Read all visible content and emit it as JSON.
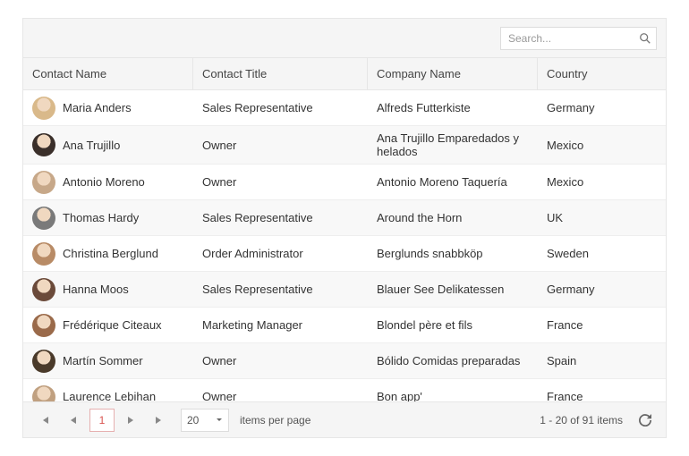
{
  "search": {
    "placeholder": "Search..."
  },
  "columns": {
    "name": "Contact Name",
    "title": "Contact Title",
    "company": "Company Name",
    "country": "Country"
  },
  "rows": [
    {
      "name": "Maria Anders",
      "title": "Sales Representative",
      "company": "Alfreds Futterkiste",
      "country": "Germany",
      "avatar": "#d9b98a"
    },
    {
      "name": "Ana Trujillo",
      "title": "Owner",
      "company": "Ana Trujillo Emparedados y helados",
      "country": "Mexico",
      "avatar": "#3a2f2a"
    },
    {
      "name": "Antonio Moreno",
      "title": "Owner",
      "company": "Antonio Moreno Taquería",
      "country": "Mexico",
      "avatar": "#c7a889"
    },
    {
      "name": "Thomas Hardy",
      "title": "Sales Representative",
      "company": "Around the Horn",
      "country": "UK",
      "avatar": "#7a7a7a"
    },
    {
      "name": "Christina Berglund",
      "title": "Order Administrator",
      "company": "Berglunds snabbköp",
      "country": "Sweden",
      "avatar": "#b88b66"
    },
    {
      "name": "Hanna Moos",
      "title": "Sales Representative",
      "company": "Blauer See Delikatessen",
      "country": "Germany",
      "avatar": "#6b4a3a"
    },
    {
      "name": "Frédérique Citeaux",
      "title": "Marketing Manager",
      "company": "Blondel père et fils",
      "country": "France",
      "avatar": "#9a6a4a"
    },
    {
      "name": "Martín Sommer",
      "title": "Owner",
      "company": "Bólido Comidas preparadas",
      "country": "Spain",
      "avatar": "#4a3a2a"
    },
    {
      "name": "Laurence Lebihan",
      "title": "Owner",
      "company": "Bon app'",
      "country": "France",
      "avatar": "#c0a080"
    }
  ],
  "pager": {
    "current_page": "1",
    "page_size": "20",
    "items_per_page_label": "items per page",
    "summary": "1 - 20 of 91 items"
  }
}
